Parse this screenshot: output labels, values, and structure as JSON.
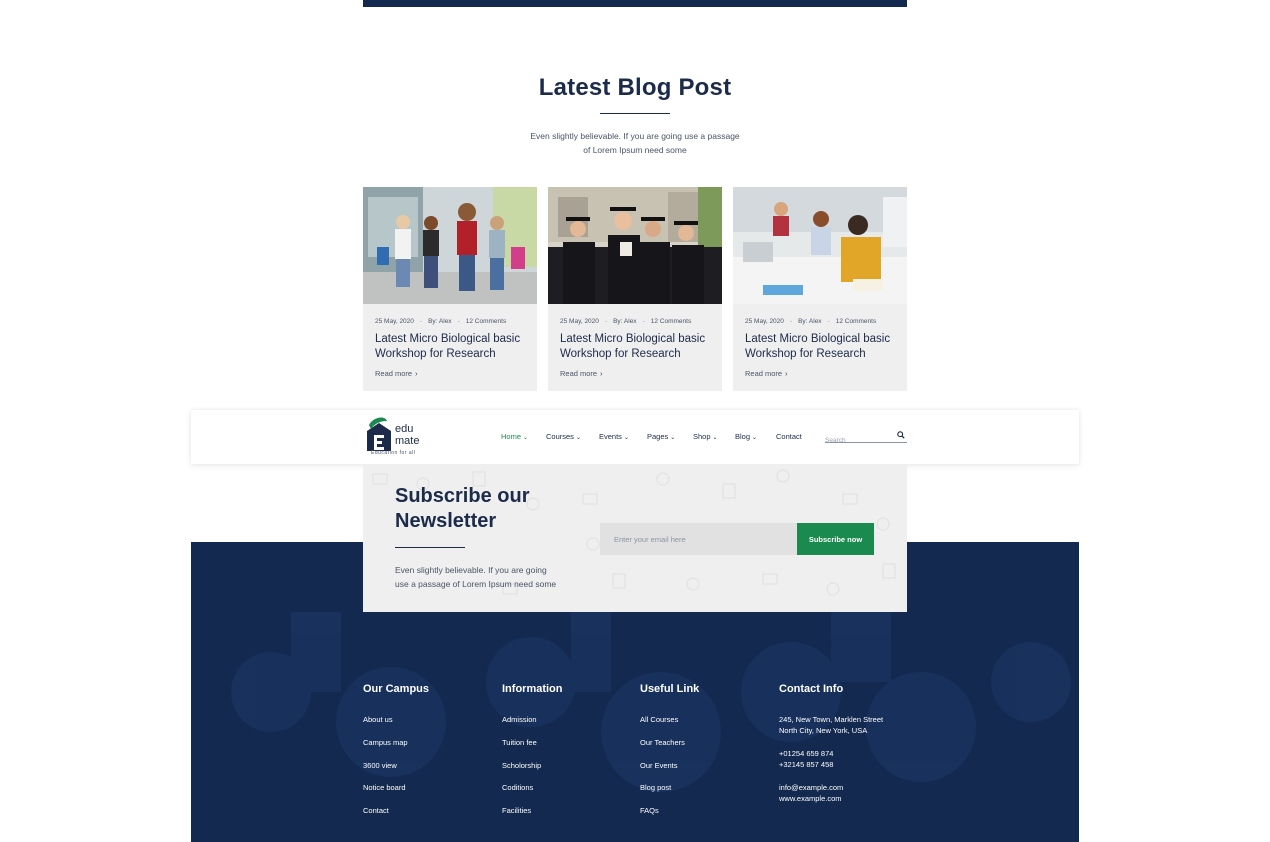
{
  "blog": {
    "title": "Latest Blog Post",
    "desc_line1": "Even slightly believable. If you are going use a passage",
    "desc_line2": "of Lorem Ipsum need some",
    "cards": [
      {
        "date": "25 May, 2020",
        "author": "By: Alex",
        "comments": "12 Comments",
        "title": "Latest Micro Biological basic Workshop for Research",
        "more": "Read more"
      },
      {
        "date": "25 May, 2020",
        "author": "By: Alex",
        "comments": "12 Comments",
        "title": "Latest Micro Biological basic Workshop for Research",
        "more": "Read more"
      },
      {
        "date": "25 May, 2020",
        "author": "By: Alex",
        "comments": "12 Comments",
        "title": "Latest Micro Biological basic Workshop for Research",
        "more": "Read more"
      }
    ]
  },
  "navbar": {
    "logo_line1": "edu",
    "logo_line2": "mate",
    "logo_tagline": "Education for all",
    "items": [
      {
        "label": "Home"
      },
      {
        "label": "Courses"
      },
      {
        "label": "Events"
      },
      {
        "label": "Pages"
      },
      {
        "label": "Shop"
      },
      {
        "label": "Blog"
      },
      {
        "label": "Contact"
      }
    ],
    "search_placeholder": "Search"
  },
  "newsletter": {
    "title_line1": "Subscribe our",
    "title_line2": "Newsletter",
    "desc_line1": "Even slightly believable. If you are going",
    "desc_line2": "use a passage of Lorem Ipsum need some",
    "email_placeholder": "Enter your email here",
    "button_label": "Subscribe now"
  },
  "footer": {
    "columns": [
      {
        "title": "Our Campus",
        "links": [
          "About us",
          "Campus map",
          "3600 view",
          "Notice board",
          "Contact"
        ]
      },
      {
        "title": "Information",
        "links": [
          "Admission",
          "Tuition fee",
          "Scholorship",
          "Coditions",
          "Facilities"
        ]
      },
      {
        "title": "Useful Link",
        "links": [
          "All Courses",
          "Our Teachers",
          "Our Events",
          "Blog post",
          "FAQs"
        ]
      }
    ],
    "contact": {
      "title": "Contact Info",
      "address_line1": "245, New Town, Marklen Street",
      "address_line2": "North City, New York, USA",
      "phone1": "+01254 659 874",
      "phone2": "+32145 857 458",
      "email": "info@example.com",
      "website": "www.example.com"
    }
  },
  "colors": {
    "navy": "#13294f",
    "heading": "#1c2b4a",
    "accent_green": "#1b8a4e",
    "card_bg": "#efefef"
  },
  "icons": [
    "search-icon",
    "chevron-right-icon",
    "chevron-down-icon",
    "logo-icon"
  ]
}
